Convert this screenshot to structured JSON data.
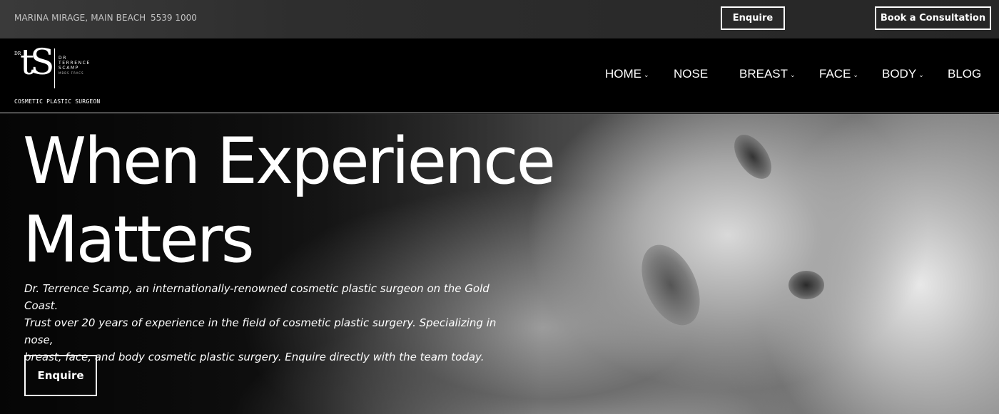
{
  "topbar": {
    "address": "MARINA MIRAGE, MAIN BEACH",
    "phone": "5539 1000",
    "enquire_label": "Enquire",
    "consult_label": "Book a Consultation"
  },
  "logo": {
    "dr": "DR",
    "monogram": "tS",
    "name_lines": [
      "DR",
      "TERRENCE",
      "SCAMP"
    ],
    "name_sub": "MBBS FRACS",
    "tagline": "COSMETIC PLASTIC SURGEON"
  },
  "nav": {
    "items": [
      {
        "label": "HOME",
        "has_dropdown": true
      },
      {
        "label": "NOSE",
        "has_dropdown": false
      },
      {
        "label": "BREAST",
        "has_dropdown": true
      },
      {
        "label": "FACE",
        "has_dropdown": true
      },
      {
        "label": "BODY",
        "has_dropdown": true
      },
      {
        "label": "BLOG",
        "has_dropdown": false
      }
    ],
    "caret_icon": "chevron-down-icon"
  },
  "hero": {
    "headline_line1": "When Experience",
    "headline_line2": "Matters",
    "intro_line1": "Dr. Terrence Scamp, an internationally-renowned cosmetic plastic surgeon on the Gold Coast.",
    "intro_line2": "Trust over 20 years of experience in the field of cosmetic plastic surgery. Specializing in nose,",
    "intro_line3": "breast, face, and body cosmetic plastic surgery. Enquire directly with the team today.",
    "enquire_label": "Enquire"
  },
  "colors": {
    "topbar_bg": "#2e2e2e",
    "header_bg": "#000000",
    "text": "#ffffff",
    "muted_text": "#c4c4c4"
  }
}
